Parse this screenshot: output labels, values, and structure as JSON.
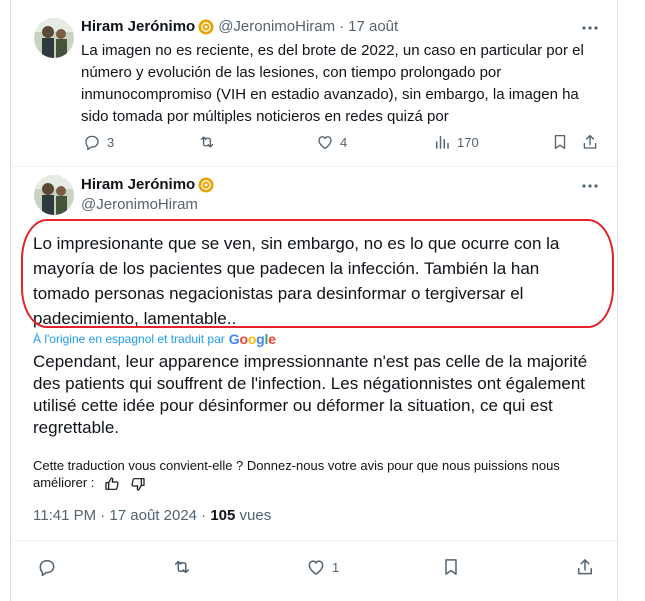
{
  "tweet1": {
    "name": "Hiram Jerónimo",
    "handle": "@JeronimoHiram",
    "separator": "·",
    "time": "17 août",
    "text": "La imagen no es reciente, es del brote de 2022, un caso en particular por el número y evolución de las lesiones, con tiempo prolongado por inmunocompromiso (VIH en estadio avanzado), sin embargo, la imagen ha sido tomada por múltiples noticieros en redes quizá por",
    "replies": "3",
    "retweets": "",
    "likes": "4",
    "views": "170"
  },
  "tweet2": {
    "name": "Hiram Jerónimo",
    "handle": "@JeronimoHiram",
    "original_text": "Lo impresionante que se ven, sin embargo, no es lo que ocurre con la mayoría de los pacientes que padecen la infección. También la han tomado personas negacionistas para desinformar o tergiversar el padecimiento, lamentable..",
    "translation_note": "À l'origine en espagnol et traduit par",
    "translation_provider": "Google",
    "translated_text": "Cependant, leur apparence impressionnante n'est pas celle de la majorité des patients qui souffrent de l'infection. Les négationnistes ont également utilisé cette idée pour désinformer ou déformer la situation, ce qui est regrettable.",
    "feedback_text": "Cette traduction vous convient-elle ? Donnez-nous votre avis pour que nous puissions nous améliorer :",
    "timestamp": "11:41 PM · 17 août 2024 · ",
    "views_count": "105",
    "views_label": " vues",
    "replies": "",
    "retweets": "",
    "likes": "1"
  },
  "colors": {
    "text": "#0f1419",
    "muted": "#536471",
    "link": "#1d9bf0",
    "highlight": "#e2232a",
    "badge": "#e8a300"
  },
  "icons": [
    "avatar-photo",
    "verified-org-badge-icon",
    "more-icon",
    "reply-icon",
    "retweet-icon",
    "like-icon",
    "views-icon",
    "bookmark-icon",
    "share-icon",
    "thumbs-up-icon",
    "thumbs-down-icon"
  ]
}
